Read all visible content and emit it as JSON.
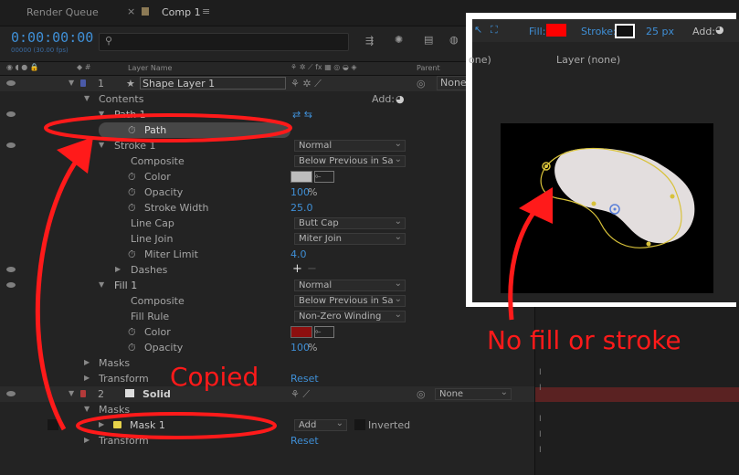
{
  "tabs": {
    "render_queue": "Render Queue",
    "comp": "Comp 1"
  },
  "timecode": {
    "value": "0:00:00:00",
    "sub": "00000 (30.00 fps)"
  },
  "columns": {
    "layer_name": "Layer Name",
    "parent": "Parent"
  },
  "layers": {
    "shape": {
      "num": "1",
      "name": "Shape Layer 1",
      "parent": "None"
    },
    "solid": {
      "num": "2",
      "name": "Solid",
      "parent": "None"
    }
  },
  "props": {
    "contents": "Contents",
    "add": "Add:",
    "path1": "Path 1",
    "path": "Path",
    "stroke1": "Stroke 1",
    "stroke_mode": "Normal",
    "composite": "Composite",
    "composite_val": "Below Previous in Sa",
    "color": "Color",
    "opacity": "Opacity",
    "opacity_val": "100",
    "stroke_width": "Stroke Width",
    "stroke_width_val": "25.0",
    "line_cap": "Line Cap",
    "line_cap_val": "Butt Cap",
    "line_join": "Line Join",
    "line_join_val": "Miter Join",
    "miter_limit": "Miter Limit",
    "miter_val": "4.0",
    "dashes": "Dashes",
    "fill1": "Fill 1",
    "fill_mode": "Normal",
    "fill_composite_val": "Below Previous in Sa",
    "fill_rule": "Fill Rule",
    "fill_rule_val": "Non-Zero Winding",
    "fill_opacity_val": "100",
    "masks": "Masks",
    "transform": "Transform",
    "reset": "Reset",
    "mask1": "Mask 1",
    "mask_mode": "Add",
    "inverted": "Inverted",
    "percent": "%"
  },
  "viewer": {
    "fill_label": "Fill:",
    "stroke_label": "Stroke:",
    "stroke_px": "25 px",
    "add_label": "Add:",
    "layer_none": "Layer (none)",
    "one_partial": "one)"
  },
  "annotations": {
    "copied": "Copied",
    "no_fill": "No fill or stroke"
  },
  "colors": {
    "accent": "#3f8fd6",
    "annotation": "#ff1a1a",
    "shape_label": "#4a5aa8",
    "solid_label": "#b33a3a",
    "mask_swatch": "#e6d24a"
  }
}
